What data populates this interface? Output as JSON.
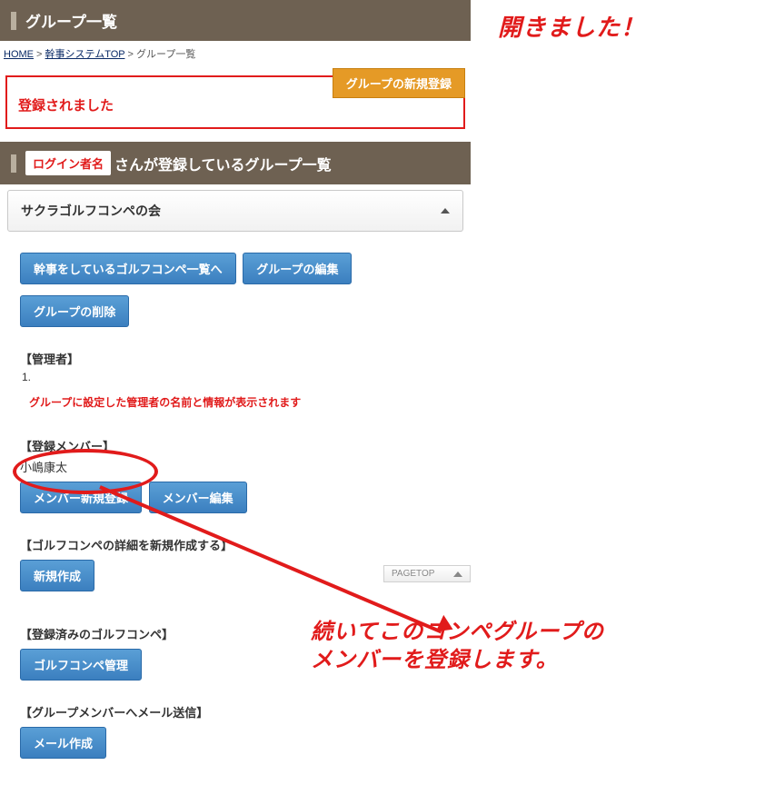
{
  "header": {
    "title": "グループ一覧"
  },
  "breadcrumb": {
    "home": "HOME",
    "sep": " > ",
    "system_top": "幹事システムTOP",
    "current": "グループ一覧"
  },
  "alert": {
    "message": "登録されました",
    "new_group_btn": "グループの新規登録"
  },
  "section": {
    "login_badge": "ログイン者名",
    "suffix": "さんが登録しているグループ一覧"
  },
  "accordion": {
    "title": "サクラゴルフコンペの会"
  },
  "buttons": {
    "to_compe_list": "幹事をしているゴルフコンペ一覧へ",
    "edit_group": "グループの編集",
    "delete_group": "グループの削除",
    "new_member": "メンバー新規登録",
    "edit_member": "メンバー編集",
    "new_create": "新規作成",
    "compe_manage": "ゴルフコンペ管理",
    "mail_create": "メール作成"
  },
  "labels": {
    "admin": "【管理者】",
    "list_num": "1.",
    "admin_note": "グループに設定した管理者の名前と情報が表示されます",
    "members": "【登録メンバー】",
    "member1": "小嶋康太",
    "compe_detail": "【ゴルフコンペの詳細を新規作成する】",
    "registered_compe": "【登録済みのゴルフコンペ】",
    "mail_send": "【グループメンバーへメール送信】"
  },
  "pagetop": "PAGETOP",
  "annotations": {
    "opened": "開きました！",
    "note_line1": "続いてこのコンペグループの",
    "note_line2": "メンバーを登録します。"
  }
}
